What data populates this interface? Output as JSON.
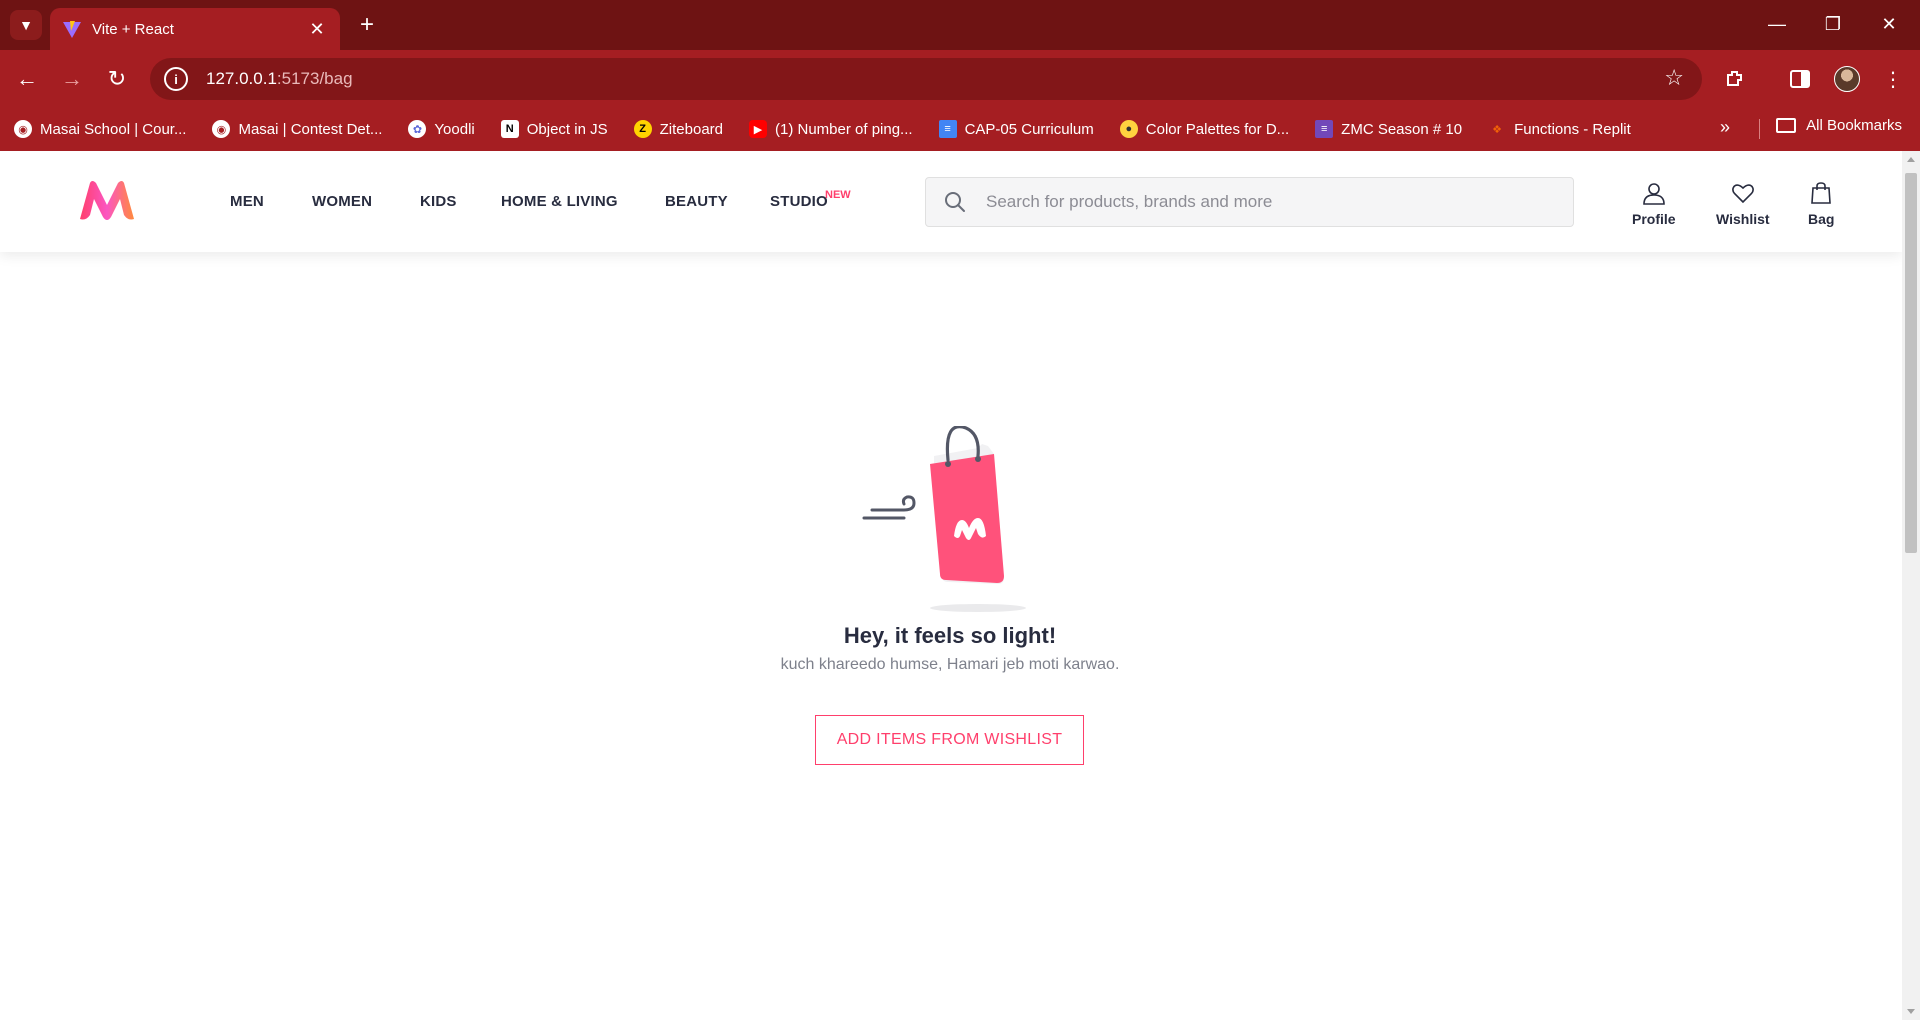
{
  "browser": {
    "tab_title": "Vite + React",
    "url_host": "127.0.0.1",
    "url_path": ":5173/bag",
    "bookmarks": [
      {
        "label": "Masai School | Cour...",
        "icon": "globe-icon"
      },
      {
        "label": "Masai | Contest Det...",
        "icon": "globe-icon"
      },
      {
        "label": "Yoodli",
        "icon": "yoodli-icon"
      },
      {
        "label": "Object in JS",
        "icon": "notion-icon"
      },
      {
        "label": "Ziteboard",
        "icon": "ziteboard-icon"
      },
      {
        "label": "(1) Number of ping...",
        "icon": "youtube-icon"
      },
      {
        "label": "CAP-05 Curriculum",
        "icon": "docs-icon"
      },
      {
        "label": "Color Palettes for D...",
        "icon": "palette-icon"
      },
      {
        "label": "ZMC Season # 10",
        "icon": "forms-icon"
      },
      {
        "label": "Functions - Replit",
        "icon": "replit-icon"
      }
    ],
    "all_bookmarks_label": "All Bookmarks"
  },
  "header": {
    "nav": [
      {
        "label": "MEN"
      },
      {
        "label": "WOMEN"
      },
      {
        "label": "KIDS"
      },
      {
        "label": "HOME & LIVING"
      },
      {
        "label": "BEAUTY"
      },
      {
        "label": "STUDIO"
      }
    ],
    "studio_badge": "NEW",
    "search_placeholder": "Search for products, brands and more",
    "actions": {
      "profile": "Profile",
      "wishlist": "Wishlist",
      "bag": "Bag"
    }
  },
  "empty_bag": {
    "title": "Hey, it feels so light!",
    "subtitle": "kuch khareedo humse, Hamari jeb moti karwao.",
    "button": "ADD ITEMS FROM WISHLIST"
  },
  "colors": {
    "chrome_dark": "#6e1313",
    "chrome": "#a51e22",
    "brand_pink": "#ff3f6c",
    "text_dark": "#282c3f"
  }
}
